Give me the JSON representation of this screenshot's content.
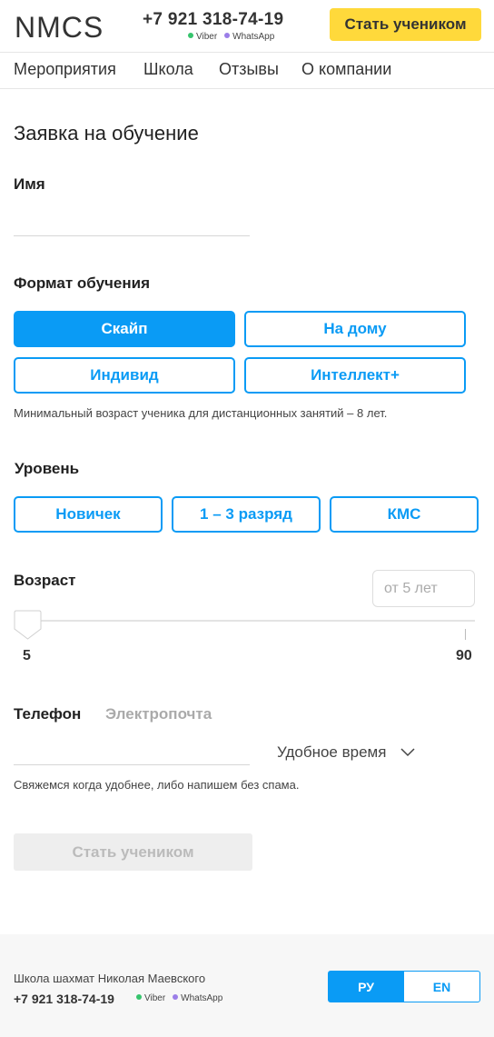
{
  "header": {
    "logo": "NMCS",
    "phone": "+7 921 318-74-19",
    "messengers": [
      "Viber",
      "WhatsApp"
    ],
    "cta_label": "Стать учеником"
  },
  "nav": {
    "items": [
      "Мероприятия",
      "Школа",
      "Отзывы",
      "О компании"
    ]
  },
  "form": {
    "title": "Заявка на обучение",
    "name_label": "Имя",
    "name_value": "",
    "format": {
      "label": "Формат обучения",
      "options": [
        "Скайп",
        "На дому",
        "Индивид",
        "Интеллект+"
      ],
      "selected": "Скайп",
      "note": "Минимальный возраст ученика для дистанционных занятий  – 8 лет."
    },
    "level": {
      "label": "Уровень",
      "options": [
        "Новичек",
        "1 – 3 разряд",
        "КМС"
      ]
    },
    "age": {
      "label": "Возраст",
      "placeholder": "от 5 лет",
      "min": "5",
      "max": "90",
      "value": 5
    },
    "contact": {
      "tabs": [
        "Телефон",
        "Электропочта"
      ],
      "active_tab": "Телефон",
      "phone_value": "",
      "time_select": "Удобное время",
      "note": "Свяжемся  когда удобнее, либо напишем без спама."
    },
    "submit_label": "Стать учеником"
  },
  "footer": {
    "school": "Школа шахмат Николая Маевского",
    "phone": "+7 921 318-74-19",
    "messengers": [
      "Viber",
      "WhatsApp"
    ],
    "languages": [
      "РУ",
      "EN"
    ],
    "active_language": "РУ"
  },
  "colors": {
    "accent": "#0a9bf5",
    "cta": "#ffd93b",
    "viber": "#36c46d",
    "whatsapp": "#9b7ee8"
  }
}
